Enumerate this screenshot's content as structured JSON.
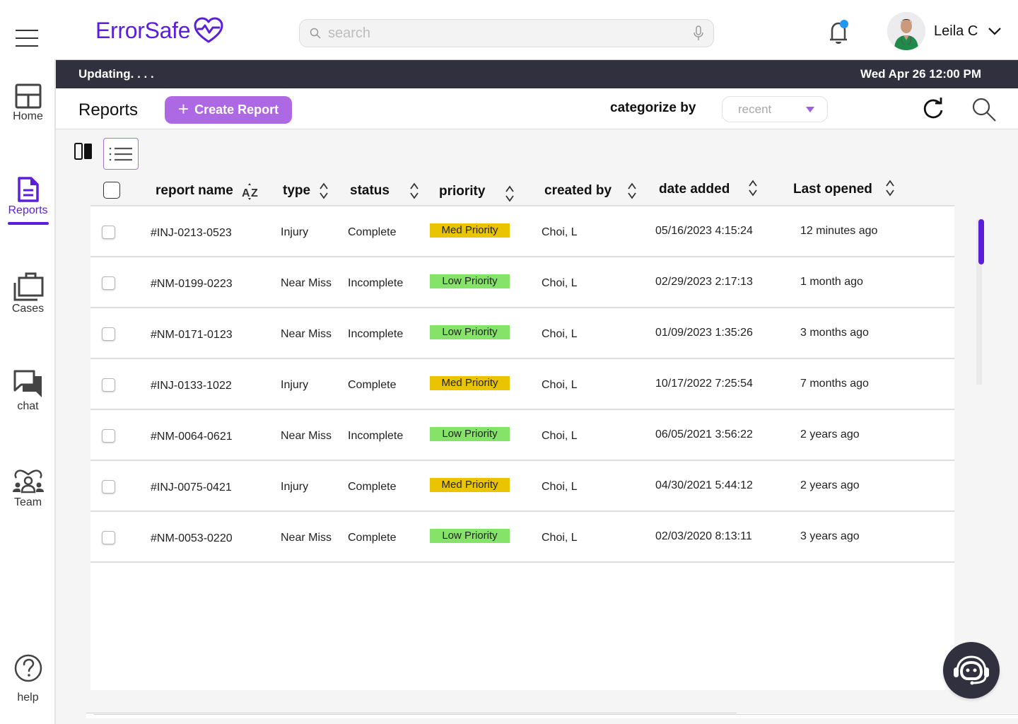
{
  "app": {
    "brand_name": "ErrorSafe",
    "brand_color": "#5b1fd9",
    "accent_color": "#ad68e4"
  },
  "topbar": {
    "menu_icon": "hamburger-menu-icon",
    "search_placeholder": "search",
    "search_value": "",
    "search_icon": "search-icon",
    "mic_icon": "microphone-icon",
    "notification_icon": "bell-icon",
    "notification_dot_color": "#2196f3",
    "user_name": "Leila C",
    "user_menu_icon": "chevron-down-icon"
  },
  "statusbar": {
    "status": "Updating. . . .",
    "datetime": "Wed Apr 26 12:00 PM"
  },
  "sidebar": {
    "items": [
      {
        "label": "Home",
        "icon": "home-layout-icon",
        "active": false
      },
      {
        "label": "Reports",
        "icon": "document-icon",
        "active": true
      },
      {
        "label": "Cases",
        "icon": "briefcase-icon",
        "active": false
      },
      {
        "label": "chat",
        "icon": "chat-bubbles-icon",
        "active": false
      },
      {
        "label": "Team",
        "icon": "team-icon",
        "active": false
      },
      {
        "label": "help",
        "icon": "help-circle-icon",
        "active": false
      }
    ]
  },
  "page_header": {
    "title": "Reports",
    "create_button": "Create Report",
    "categorize_label": "categorize by",
    "categorize_value": "recent",
    "refresh_icon": "refresh-icon",
    "search_icon": "search-icon"
  },
  "view_toggle": {
    "options": [
      "split-view",
      "list-view"
    ],
    "selected": "list-view"
  },
  "table": {
    "columns": [
      "report name",
      "type",
      "status",
      "priority",
      "created by",
      "date added",
      "Last opened"
    ],
    "priority_colors": {
      "Med Priority": "#ebc400",
      "Low Priority": "#86e36a"
    },
    "rows": [
      {
        "checked": false,
        "report_name": "#INJ-0213-0523",
        "type": "Injury",
        "status": "Complete",
        "priority": "Med Priority",
        "created_by": "Choi, L",
        "date_added": "05/16/2023 4:15:24",
        "last_opened": "12 minutes ago"
      },
      {
        "checked": false,
        "report_name": "#NM-0199-0223",
        "type": "Near Miss",
        "status": "Incomplete",
        "priority": "Low Priority",
        "created_by": "Choi, L",
        "date_added": "02/29/2023 2:17:13",
        "last_opened": "1 month ago"
      },
      {
        "checked": false,
        "report_name": "#NM-0171-0123",
        "type": "Near Miss",
        "status": "Incomplete",
        "priority": "Low Priority",
        "created_by": "Choi, L",
        "date_added": "01/09/2023 1:35:26",
        "last_opened": "3 months ago"
      },
      {
        "checked": false,
        "report_name": "#INJ-0133-1022",
        "type": "Injury",
        "status": "Complete",
        "priority": "Med Priority",
        "created_by": "Choi, L",
        "date_added": "10/17/2022 7:25:54",
        "last_opened": "7 months ago"
      },
      {
        "checked": false,
        "report_name": "#NM-0064-0621",
        "type": "Near Miss",
        "status": "Incomplete",
        "priority": "Low Priority",
        "created_by": "Choi, L",
        "date_added": "06/05/2021 3:56:22",
        "last_opened": "2 years ago"
      },
      {
        "checked": false,
        "report_name": "#INJ-0075-0421",
        "type": "Injury",
        "status": "Complete",
        "priority": "Med Priority",
        "created_by": "Choi, L",
        "date_added": "04/30/2021 5:44:12",
        "last_opened": "2 years ago"
      },
      {
        "checked": false,
        "report_name": "#NM-0053-0220",
        "type": "Near Miss",
        "status": "Complete",
        "priority": "Low Priority",
        "created_by": "Choi, L",
        "date_added": "02/03/2020 8:13:11",
        "last_opened": "3 years ago"
      }
    ]
  },
  "chatbot": {
    "icon": "support-bot-icon"
  }
}
